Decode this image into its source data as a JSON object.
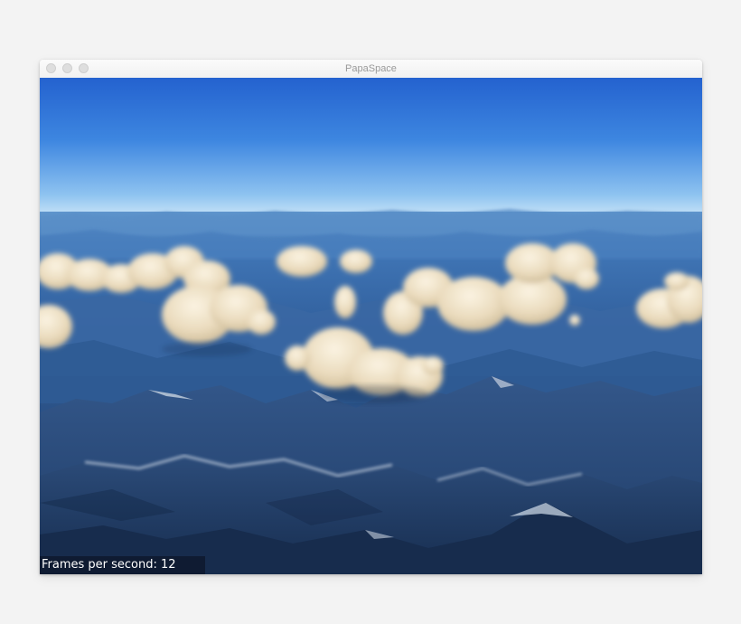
{
  "window": {
    "title": "PapaSpace"
  },
  "overlay": {
    "fps_text": "Frames per second: 12"
  },
  "colors": {
    "sky_top": "#2a6bd6",
    "sky_horizon": "#bcdcf6",
    "mountain_dark": "#1f3a63",
    "cloud": "#f1e6cf"
  },
  "icons": {
    "close": "window-close-dot",
    "minimize": "window-minimize-dot",
    "zoom": "window-zoom-dot"
  }
}
